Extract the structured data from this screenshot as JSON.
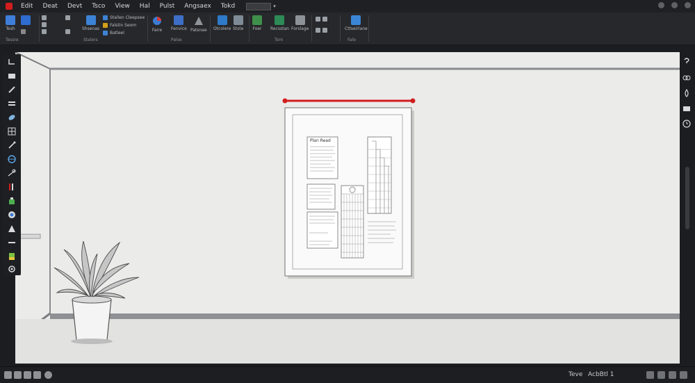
{
  "menubar": {
    "items": [
      "Edit",
      "Deat",
      "Devt",
      "Tsco",
      "View",
      "Hal",
      "Pulst",
      "Angsaex",
      "Tokd"
    ],
    "search_text": "",
    "caret": "▾"
  },
  "ribbon": {
    "group1": {
      "btn1": "Tesh",
      "btn2": "",
      "label": "Tessre"
    },
    "group2": {
      "btn1": "Shsenas",
      "text1": "Stallen Cleepsee",
      "text2": "Falstin Seom",
      "text3": "Batleel",
      "label": "Stalers"
    },
    "group3": {
      "btn1": "Faire",
      "btn2": "Fenvice",
      "btn3": "Patsnae",
      "label": "Palse"
    },
    "group4": {
      "btn1": "Otcolere",
      "btn2": "Stste",
      "label": ""
    },
    "group5": {
      "btn1": "Foer",
      "btn2": "Recsstan",
      "btn3": "Forslage",
      "label": "Torn"
    },
    "group6": {
      "label": ""
    },
    "group7": {
      "btn1": "Cttseirlane",
      "label": "Fale"
    }
  },
  "document": {
    "heading": "Plan Read"
  },
  "statusbar": {
    "left_text": "Teve",
    "right_text": "AcbBtl 1"
  },
  "colors": {
    "accent_red": "#d21d1d",
    "chrome_dark": "#1f2023",
    "canvas": "#ebebea"
  }
}
